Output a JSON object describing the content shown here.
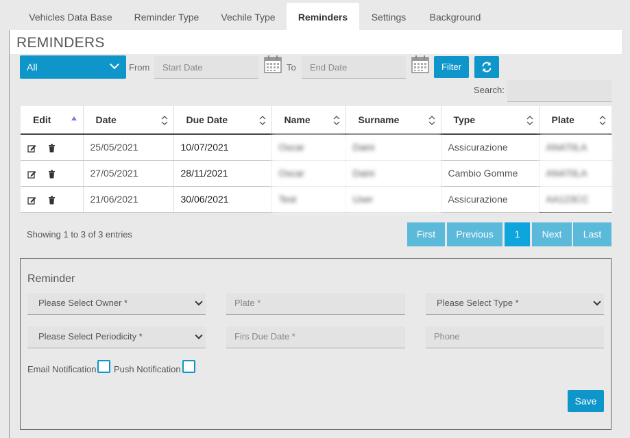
{
  "tabs": [
    {
      "label": "Vehicles Data Base"
    },
    {
      "label": "Reminder Type"
    },
    {
      "label": "Vechile Type"
    },
    {
      "label": "Reminders"
    },
    {
      "label": "Settings"
    },
    {
      "label": "Background"
    }
  ],
  "page_title": "REMINDERS",
  "filter": {
    "owner_select": "All",
    "from_label": "From",
    "start_placeholder": "Start Date",
    "to_label": "To",
    "end_placeholder": "End Date",
    "filter_button": "Filter",
    "refresh_icon": "refresh-icon",
    "calendar_icon": "calendar-icon"
  },
  "search": {
    "label": "Search:",
    "value": ""
  },
  "table": {
    "headers": [
      "Edit",
      "Date",
      "Due Date",
      "Name",
      "Surname",
      "Type",
      "Plate"
    ],
    "rows": [
      {
        "date": "25/05/2021",
        "due": "10/07/2021",
        "name": "Oscar",
        "surname": "Daini",
        "type": "Assicurazione",
        "plate": "AN470LA"
      },
      {
        "date": "27/05/2021",
        "due": "28/11/2021",
        "name": "Oscar",
        "surname": "Daini",
        "type": "Cambio Gomme",
        "plate": "AN470LA"
      },
      {
        "date": "21/06/2021",
        "due": "30/06/2021",
        "name": "Test",
        "surname": "User",
        "type": "Assicurazione",
        "plate": "AA123CC"
      }
    ]
  },
  "pager": {
    "info": "Showing 1 to 3 of 3 entries",
    "first": "First",
    "previous": "Previous",
    "current": "1",
    "next": "Next",
    "last": "Last"
  },
  "form": {
    "title": "Reminder",
    "owner": "Please Select Owner *",
    "plate": "Plate *",
    "type": "Please Select Type *",
    "periodicity": "Please Select Periodicity *",
    "first_due": "Firs Due Date *",
    "phone": "Phone",
    "email_notification": "Email Notification",
    "push_notification": "Push Notification",
    "save": "Save"
  },
  "colors": {
    "accent": "#0e95c9",
    "pager": "#5bb9d9",
    "pager_active": "#0ea5dd"
  }
}
